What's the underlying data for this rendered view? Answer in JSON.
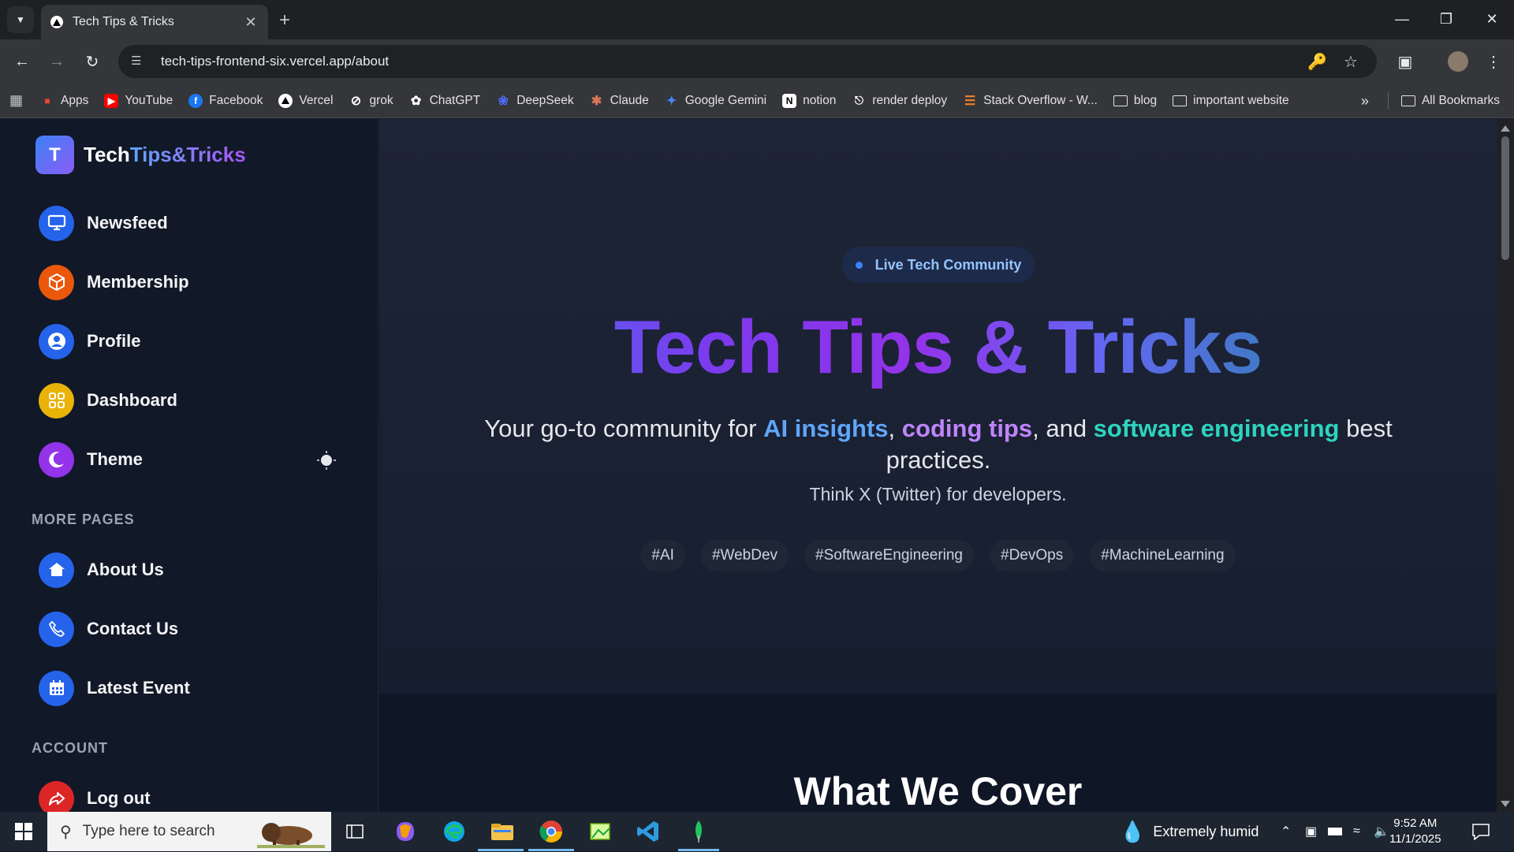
{
  "browser": {
    "tab_title": "Tech Tips & Tricks",
    "url": "tech-tips-frontend-six.vercel.app/about",
    "bookmarks": [
      {
        "label": "Apps",
        "icon": "apps-grid-icon",
        "color": "#ea4335"
      },
      {
        "label": "YouTube",
        "icon": "youtube-icon",
        "color": "#ff0000"
      },
      {
        "label": "Facebook",
        "icon": "facebook-icon",
        "color": "#1877f2"
      },
      {
        "label": "Vercel",
        "icon": "vercel-icon",
        "color": "#000000"
      },
      {
        "label": "grok",
        "icon": "grok-icon",
        "color": "#ffffff"
      },
      {
        "label": "ChatGPT",
        "icon": "chatgpt-icon",
        "color": "#ffffff"
      },
      {
        "label": "DeepSeek",
        "icon": "deepseek-icon",
        "color": "#4d6bfe"
      },
      {
        "label": "Claude",
        "icon": "claude-icon",
        "color": "#d97757"
      },
      {
        "label": "Google Gemini",
        "icon": "gemini-icon",
        "color": "#4285f4"
      },
      {
        "label": "notion",
        "icon": "notion-icon",
        "color": "#ffffff"
      },
      {
        "label": "render deploy",
        "icon": "render-icon",
        "color": "#ffffff"
      },
      {
        "label": "Stack Overflow - W...",
        "icon": "stackoverflow-icon",
        "color": "#f48024"
      },
      {
        "label": "blog",
        "icon": "folder-icon",
        "color": "#e3e3e3"
      },
      {
        "label": "important website",
        "icon": "folder-icon",
        "color": "#e3e3e3"
      }
    ],
    "all_bookmarks": "All Bookmarks"
  },
  "sidebar": {
    "logo_letter": "T",
    "logo_text_a": "Tech",
    "logo_text_b": "Tips&Tricks",
    "nav": [
      {
        "label": "Newsfeed",
        "icon": "monitor-icon",
        "color": "#2563eb"
      },
      {
        "label": "Membership",
        "icon": "box-icon",
        "color": "#ea580c"
      },
      {
        "label": "Profile",
        "icon": "user-circle-icon",
        "color": "#2563eb"
      },
      {
        "label": "Dashboard",
        "icon": "grid-icon",
        "color": "#eab308"
      },
      {
        "label": "Theme",
        "icon": "moon-icon",
        "color": "#9333ea"
      }
    ],
    "more_pages_heading": "MORE PAGES",
    "more_pages": [
      {
        "label": "About Us",
        "icon": "home-icon",
        "color": "#2563eb"
      },
      {
        "label": "Contact Us",
        "icon": "phone-icon",
        "color": "#2563eb"
      },
      {
        "label": "Latest Event",
        "icon": "calendar-icon",
        "color": "#2563eb"
      }
    ],
    "account_heading": "ACCOUNT",
    "account": [
      {
        "label": "Log out",
        "icon": "logout-icon",
        "color": "#dc2626"
      }
    ]
  },
  "hero": {
    "badge": "Live Tech Community",
    "title": "Tech Tips & Tricks",
    "sub_1": "Your go-to community for ",
    "kw_1": "AI insights",
    "sub_2": ", ",
    "kw_2": "coding tips",
    "sub_3": ", and ",
    "kw_3": "software engineering",
    "sub_4": " best practices.",
    "think": "Think X (Twitter) for developers.",
    "tags": [
      "#AI",
      "#WebDev",
      "#SoftwareEngineering",
      "#DevOps",
      "#MachineLearning"
    ]
  },
  "section_title": "What We Cover",
  "taskbar": {
    "search_placeholder": "Type here to search",
    "weather": "Extremely humid",
    "time": "9:52 AM",
    "date": "11/1/2025"
  }
}
